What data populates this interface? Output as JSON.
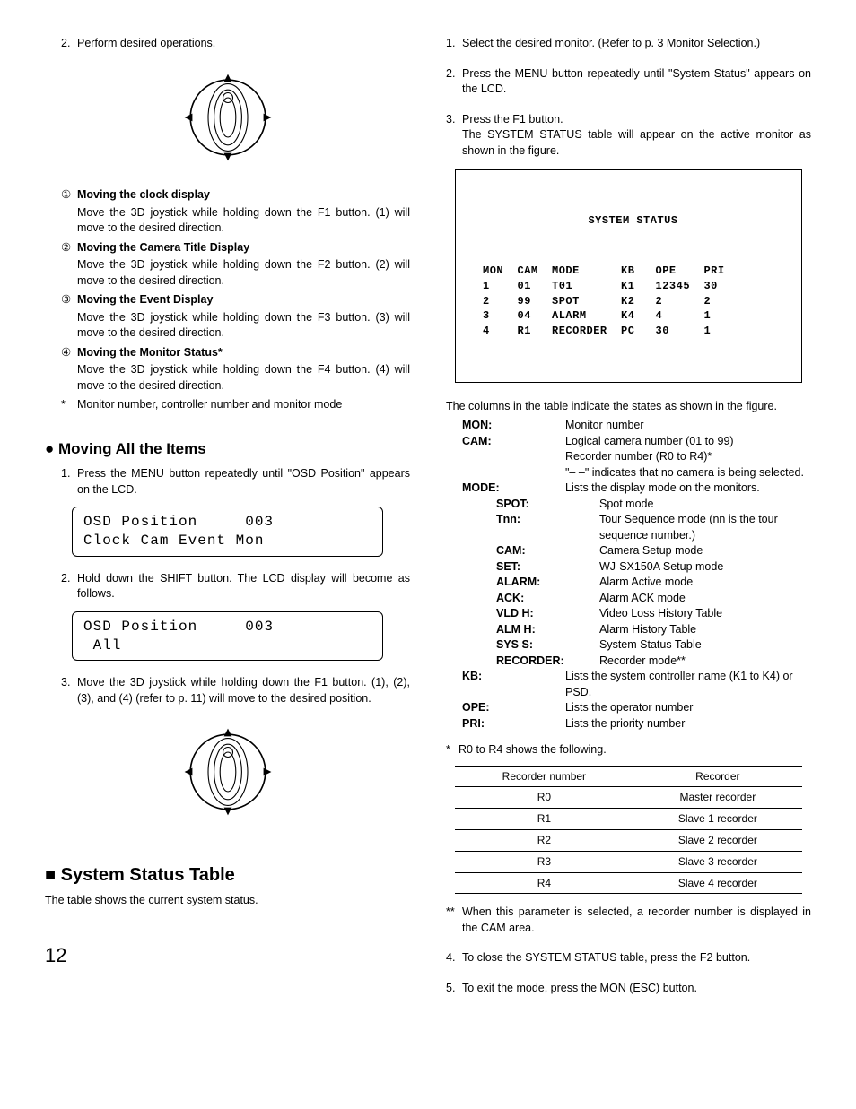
{
  "left": {
    "s2_num": "2.",
    "s2_text": "Perform desired operations.",
    "c1_mark": "①",
    "c1_title": "Moving the clock display",
    "c1_body": "Move the 3D joystick while holding down the F1 button. (1) will move to the desired direction.",
    "c2_mark": "②",
    "c2_title": "Moving the Camera Title Display",
    "c2_body": "Move the 3D joystick while holding down the F2 button. (2) will move to the desired direction.",
    "c3_mark": "③",
    "c3_title": "Moving the Event Display",
    "c3_body": "Move the 3D joystick while holding down the F3 button. (3) will move to the desired direction.",
    "c4_mark": "④",
    "c4_title": "Moving the Monitor Status*",
    "c4_body": "Move the 3D joystick while holding down the F4 button. (4) will move to the desired direction.",
    "star_mark": "*",
    "star_body": "Monitor number, controller number and monitor mode",
    "h_moving_all": "Moving All the Items",
    "m1_num": "1.",
    "m1_body": "Press the MENU button repeatedly until \"OSD Position\" appears on the LCD.",
    "lcd1": "OSD Position     003\nClock Cam Event Mon",
    "m2_num": "2.",
    "m2_body": "Hold down the SHIFT button. The LCD display will become as follows.",
    "lcd2": "OSD Position     003\n All",
    "m3_num": "3.",
    "m3_body": "Move the 3D joystick while holding down the F1 button. (1), (2), (3), and (4) (refer to p. 11) will move to the desired position.",
    "h_system_status": "System Status Table",
    "sst_intro": "The table shows the current system status.",
    "pagenum": "12"
  },
  "right": {
    "r1_num": "1.",
    "r1_body": "Select the desired monitor. (Refer to p. 3 Monitor Selection.)",
    "r2_num": "2.",
    "r2_body": "Press the MENU button repeatedly until \"System Status\" appears on the LCD.",
    "r3_num": "3.",
    "r3_body_a": "Press the F1 button.",
    "r3_body_b": "The SYSTEM STATUS table will appear on the active monitor as shown in the figure.",
    "status_title": "SYSTEM STATUS",
    "status_rows": "MON  CAM  MODE      KB   OPE    PRI\n1    01   T01       K1   12345  30\n2    99   SPOT      K2   2      2\n3    04   ALARM     K4   4      1\n4    R1   RECORDER  PC   30     1",
    "cols_intro": "The columns in the table indicate the states as shown in the figure.",
    "d_mon_k": "MON:",
    "d_mon_v": "Monitor number",
    "d_cam_k": "CAM:",
    "d_cam_v1": "Logical camera number (01 to 99)",
    "d_cam_v2": "Recorder number (R0 to R4)*",
    "d_cam_v3": "\"– –\" indicates that no camera is being selected.",
    "d_mode_k": "MODE:",
    "d_mode_v": "Lists the display mode on the monitors.",
    "d_spot_k": "SPOT:",
    "d_spot_v": "Spot mode",
    "d_tnn_k": "Tnn:",
    "d_tnn_v": "Tour Sequence mode (nn is the tour sequence number.)",
    "d_cams_k": "CAM:",
    "d_cams_v": "Camera Setup mode",
    "d_set_k": "SET:",
    "d_set_v": "WJ-SX150A Setup mode",
    "d_alarm_k": "ALARM:",
    "d_alarm_v": "Alarm Active mode",
    "d_ack_k": "ACK:",
    "d_ack_v": "Alarm ACK mode",
    "d_vldh_k": "VLD H:",
    "d_vldh_v": "Video Loss History Table",
    "d_almh_k": "ALM H:",
    "d_almh_v": "Alarm History Table",
    "d_syss_k": "SYS S:",
    "d_syss_v": "System Status Table",
    "d_rec_k": "RECORDER:",
    "d_rec_v": "Recorder mode**",
    "d_kb_k": "KB:",
    "d_kb_v": "Lists the system controller name (K1 to K4) or PSD.",
    "d_ope_k": "OPE:",
    "d_ope_v": "Lists the operator number",
    "d_pri_k": "PRI:",
    "d_pri_v": "Lists the priority number",
    "star1_mark": "*",
    "star1_body": "R0 to R4 shows the following.",
    "rec_h1": "Recorder number",
    "rec_h2": "Recorder",
    "rec_r0a": "R0",
    "rec_r0b": "Master recorder",
    "rec_r1a": "R1",
    "rec_r1b": "Slave 1 recorder",
    "rec_r2a": "R2",
    "rec_r2b": "Slave 2 recorder",
    "rec_r3a": "R3",
    "rec_r3b": "Slave 3 recorder",
    "rec_r4a": "R4",
    "rec_r4b": "Slave 4 recorder",
    "star2_mark": "**",
    "star2_body": "When this parameter is selected, a recorder number is displayed in the CAM area.",
    "r4_num": "4.",
    "r4_body": "To close the SYSTEM STATUS table, press the F2 button.",
    "r5_num": "5.",
    "r5_body": "To exit the mode, press the MON (ESC) button."
  }
}
